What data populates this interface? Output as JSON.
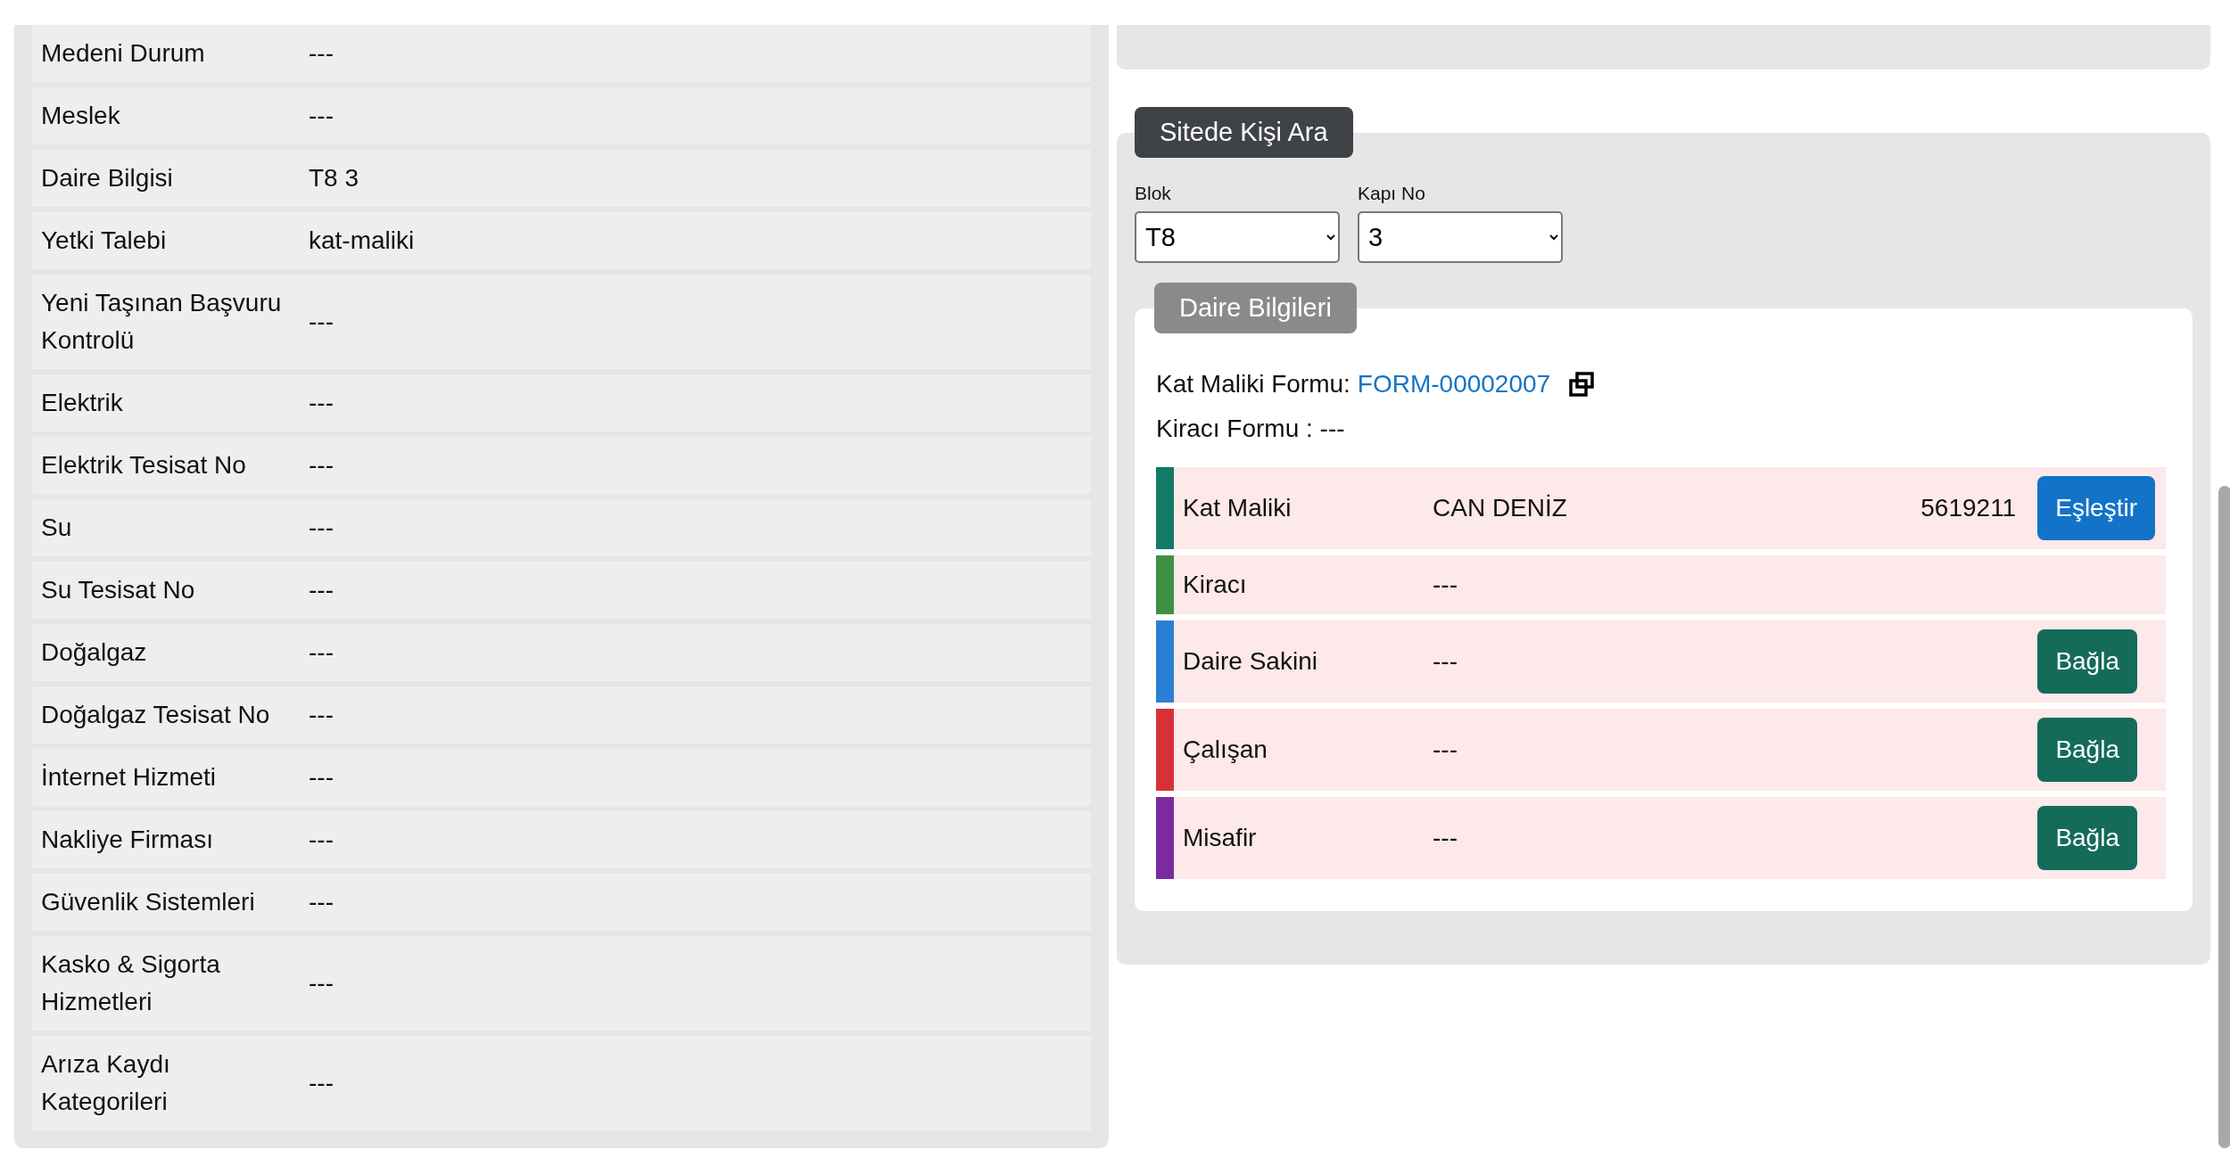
{
  "details": [
    {
      "label": "Medeni Durum",
      "value": "---"
    },
    {
      "label": "Meslek",
      "value": "---"
    },
    {
      "label": "Daire Bilgisi",
      "value": "T8 3"
    },
    {
      "label": "Yetki Talebi",
      "value": "kat-maliki"
    },
    {
      "label": "Yeni Taşınan Başvuru Kontrolü",
      "value": "---"
    },
    {
      "label": "Elektrik",
      "value": "---"
    },
    {
      "label": "Elektrik Tesisat No",
      "value": "---"
    },
    {
      "label": "Su",
      "value": "---"
    },
    {
      "label": "Su Tesisat No",
      "value": "---"
    },
    {
      "label": "Doğalgaz",
      "value": "---"
    },
    {
      "label": "Doğalgaz Tesisat No",
      "value": "---"
    },
    {
      "label": "İnternet Hizmeti",
      "value": "---"
    },
    {
      "label": "Nakliye Firması",
      "value": "---"
    },
    {
      "label": "Güvenlik Sistemleri",
      "value": "---"
    },
    {
      "label": "Kasko & Sigorta Hizmetleri",
      "value": "---"
    },
    {
      "label": "Arıza Kaydı Kategorileri",
      "value": "---"
    }
  ],
  "search": {
    "title": "Sitede Kişi Ara",
    "fields": [
      {
        "label": "Blok",
        "value": "T8"
      },
      {
        "label": "Kapı No",
        "value": "3"
      }
    ]
  },
  "apartment": {
    "title": "Daire Bilgileri",
    "owner_form_label": "Kat Maliki Formu:",
    "owner_form_link": "FORM-00002007",
    "tenant_form": "Kiracı Formu : ---",
    "residents": [
      {
        "role": "Kat Maliki",
        "name": "CAN DENİZ",
        "number": "5619211",
        "color": "#127a66",
        "action": {
          "label": "Eşleştir",
          "kind": "match"
        }
      },
      {
        "role": "Kiracı",
        "name": "---",
        "color": "#3e9142"
      },
      {
        "role": "Daire Sakini",
        "name": "---",
        "color": "#2a7fd4",
        "action": {
          "label": "Bağla",
          "kind": "link"
        }
      },
      {
        "role": "Çalışan",
        "name": "---",
        "color": "#d63236",
        "action": {
          "label": "Bağla",
          "kind": "link"
        }
      },
      {
        "role": "Misafir",
        "name": "---",
        "color": "#7b2aa0",
        "action": {
          "label": "Bağla",
          "kind": "link"
        }
      }
    ]
  }
}
